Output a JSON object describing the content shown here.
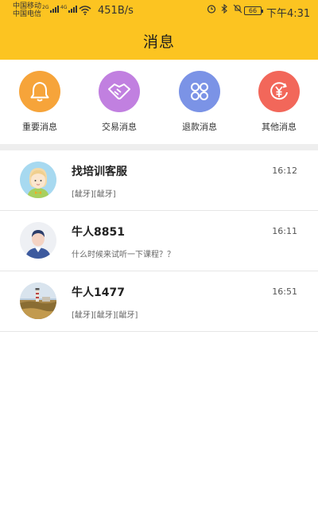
{
  "status_bar": {
    "carrier_1": "中国移动",
    "carrier_2": "中国电信",
    "net_tag_1": "2G",
    "net_tag_2": "4G",
    "net_speed": "451B/s",
    "battery": "66",
    "time": "下午4:31"
  },
  "header": {
    "title": "消息"
  },
  "categories": [
    {
      "label": "重要消息",
      "color": "#f6a43a",
      "icon": "bell-icon"
    },
    {
      "label": "交易消息",
      "color": "#c180e0",
      "icon": "handshake-icon"
    },
    {
      "label": "退款消息",
      "color": "#7b93e6",
      "icon": "clover-icon"
    },
    {
      "label": "其他消息",
      "color": "#f2675a",
      "icon": "yen-icon"
    }
  ],
  "messages": [
    {
      "name": "找培训客服",
      "time": "16:12",
      "preview": "[龇牙][龇牙]",
      "avatar": "cartoon-girl-avatar"
    },
    {
      "name": "牛人8851",
      "time": "16:11",
      "preview": "什么时候来试听一下课程？？",
      "avatar": "default-person-avatar"
    },
    {
      "name": "牛人1477",
      "time": "16:51",
      "preview": "[龇牙][龇牙][龇牙]",
      "avatar": "lighthouse-photo-avatar"
    }
  ],
  "colors": {
    "header_bg": "#fcc421",
    "divider": "#eeeeee"
  }
}
